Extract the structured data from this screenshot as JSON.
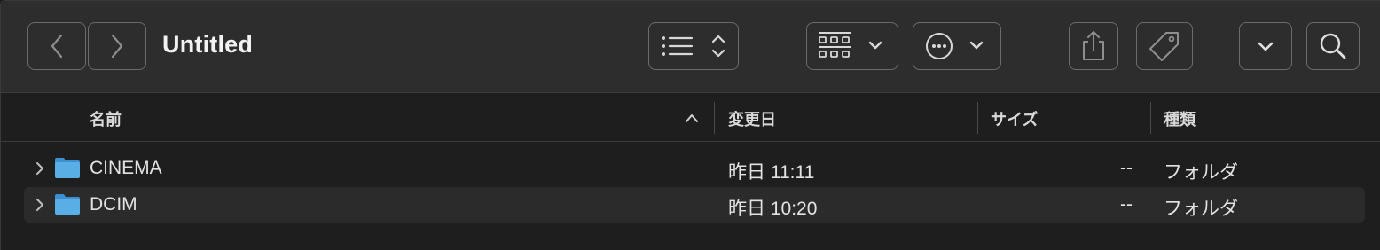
{
  "window": {
    "title": "Untitled"
  },
  "toolbar": {
    "buttons": [
      {
        "name": "back-button",
        "icon": "chevron-left-icon"
      },
      {
        "name": "forward-button",
        "icon": "chevron-right-icon"
      },
      {
        "name": "view-options-button",
        "icon": "list-view-icon"
      },
      {
        "name": "group-button",
        "icon": "grid-group-icon"
      },
      {
        "name": "more-actions-button",
        "icon": "ellipsis-circle-icon"
      },
      {
        "name": "share-button",
        "icon": "share-icon"
      },
      {
        "name": "tag-button",
        "icon": "tag-icon"
      },
      {
        "name": "overflow-button",
        "icon": "chevron-down-icon"
      },
      {
        "name": "search-button",
        "icon": "magnifier-icon"
      }
    ]
  },
  "columns": {
    "name": "名前",
    "date": "変更日",
    "size": "サイズ",
    "kind": "種類",
    "sort_indicator": "^"
  },
  "rows": [
    {
      "name": "CINEMA",
      "date": "昨日 11:11",
      "size": "--",
      "kind": "フォルダ"
    },
    {
      "name": "DCIM",
      "date": "昨日 10:20",
      "size": "--",
      "kind": "フォルダ"
    }
  ],
  "colors": {
    "toolbar_bg": "#2d2d2d",
    "list_bg": "#1e1e1e",
    "alt_row_bg": "#2b2b2b",
    "folder_blue": "#5aaee6"
  }
}
